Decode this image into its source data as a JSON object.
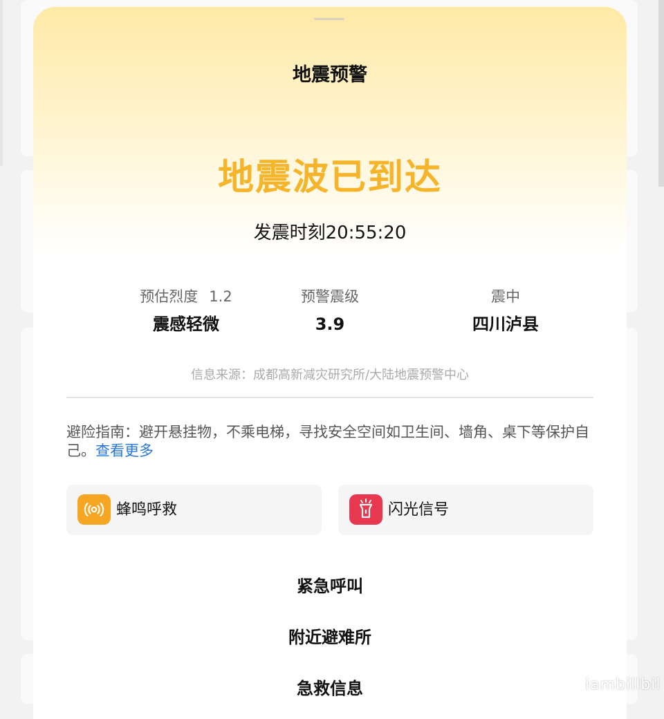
{
  "sheet": {
    "title": "地震预警",
    "headline": "地震波已到达",
    "time_label": "发震时刻",
    "time_value": "20:55:20"
  },
  "metrics": [
    {
      "label": "预估烈度",
      "label_value": "1.2",
      "value": "震感轻微"
    },
    {
      "label": "预警震级",
      "value": "3.9"
    },
    {
      "label": "震中",
      "value": "四川泸县"
    }
  ],
  "source": "信息来源：成都高新减灾研究所/大陆地震预警中心",
  "guide": {
    "text": "避险指南：避开悬挂物，不乘电梯，寻找安全空间如卫生间、墙角、桌下等保护自己。",
    "more_link": "查看更多"
  },
  "actions": [
    {
      "label": "蜂鸣呼救",
      "icon": "beacon-icon",
      "color": "#f5a623"
    },
    {
      "label": "闪光信号",
      "icon": "flashlight-icon",
      "color": "#e8384f"
    }
  ],
  "links": [
    "紧急呼叫",
    "附近避难所",
    "急救信息"
  ],
  "watermark": "iambillbil",
  "colors": {
    "accent": "#f6b42a",
    "link": "#2878d8"
  }
}
